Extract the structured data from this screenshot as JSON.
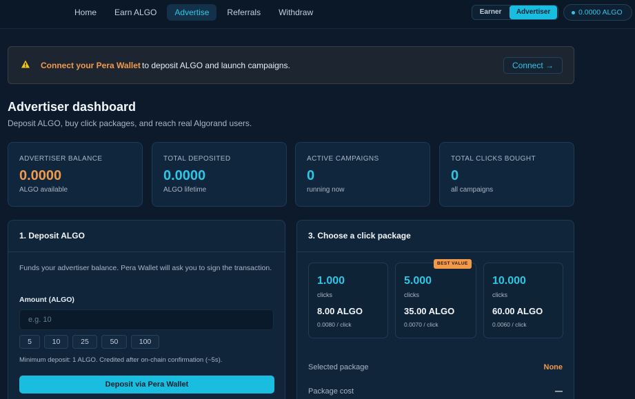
{
  "nav": {
    "links": [
      "Home",
      "Earn ALGO",
      "Advertise",
      "Referrals",
      "Withdraw"
    ],
    "active": "Advertise",
    "role_earner": "Earner",
    "role_advertiser": "Advertiser",
    "wallet_balance": "0.0000 ALGO"
  },
  "banner": {
    "strong": "Connect your Pera Wallet",
    "text": "to deposit ALGO and launch campaigns.",
    "connect_label": "Connect →"
  },
  "header": {
    "title": "Advertiser dashboard",
    "subtitle": "Deposit ALGO, buy click packages, and reach real Algorand users."
  },
  "stats": [
    {
      "label": "ADVERTISER BALANCE",
      "value": "0.0000",
      "note": "ALGO available"
    },
    {
      "label": "TOTAL DEPOSITED",
      "value": "0.0000",
      "note": "ALGO lifetime"
    },
    {
      "label": "ACTIVE CAMPAIGNS",
      "value": "0",
      "note": "running now"
    },
    {
      "label": "TOTAL CLICKS BOUGHT",
      "value": "0",
      "note": "all campaigns"
    }
  ],
  "deposit": {
    "title": "1. Deposit ALGO",
    "description": "Funds your advertiser balance. Pera Wallet will ask you to sign the transaction.",
    "amount_label": "Amount (ALGO)",
    "placeholder": "e.g. 10",
    "value": "",
    "presets": [
      "5",
      "10",
      "25",
      "50",
      "100"
    ],
    "min_note": "Minimum deposit: 1 ALGO. Credited after on-chain confirmation (~5s).",
    "button_label": "Deposit via Pera Wallet"
  },
  "packages": {
    "title": "3. Choose a click package",
    "items": [
      {
        "count": "1.000",
        "unit": "clicks",
        "price": "8.00 ALGO",
        "per": "0.0080 / click"
      },
      {
        "count": "5.000",
        "unit": "clicks",
        "price": "35.00 ALGO",
        "per": "0.0070 / click",
        "badge": "BEST VALUE"
      },
      {
        "count": "10.000",
        "unit": "clicks",
        "price": "60.00 ALGO",
        "per": "0.0060 / click"
      }
    ],
    "selected_label": "Selected package",
    "selected_value": "None",
    "cost_label": "Package cost",
    "cost_value": "—"
  },
  "colors": {
    "accent": "#18bde0",
    "orange": "#f29a4c",
    "background": "#0c1a2b",
    "card": "#10263c"
  }
}
